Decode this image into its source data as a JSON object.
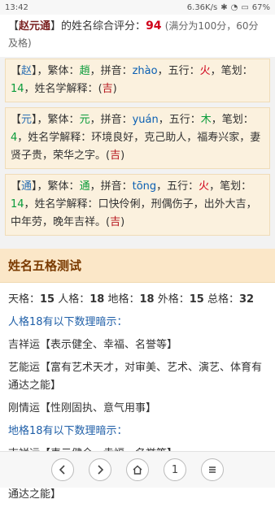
{
  "status": {
    "time": "13:42",
    "network_speed": "6.36K/s",
    "battery": "67%"
  },
  "score": {
    "name_open": "【",
    "name": "赵元通",
    "name_close": "】",
    "text1": "的姓名综合评分：",
    "score_value": "94",
    "note": "(满分为100分，60分及格)"
  },
  "chars": [
    {
      "lb": "【",
      "char": "赵",
      "rb": "】",
      "text_trad_label": "，繁体：",
      "trad": "趙",
      "text_py_label": "，拼音：",
      "pinyin": "zhào",
      "text_wx_label": "，五行：",
      "wuxing": "火",
      "text_bh_label": "，笔划：",
      "strokes": "14",
      "text_expl_label": "，姓名学解释：",
      "expl": "",
      "luck_open": "(",
      "luck": "吉",
      "luck_close": ")"
    },
    {
      "lb": "【",
      "char": "元",
      "rb": "】",
      "text_trad_label": "，繁体：",
      "trad": "元",
      "text_py_label": "，拼音：",
      "pinyin": "yuán",
      "text_wx_label": "，五行：",
      "wuxing": "木",
      "text_bh_label": "，笔划：",
      "strokes": "4",
      "text_expl_label": "，姓名学解释：",
      "expl": "环境良好，克己助人，福寿兴家，妻贤子贵，荣华之字。",
      "luck_open": "(",
      "luck": "吉",
      "luck_close": ")"
    },
    {
      "lb": "【",
      "char": "通",
      "rb": "】",
      "text_trad_label": "，繁体：",
      "trad": "通",
      "text_py_label": "，拼音：",
      "pinyin": "tōng",
      "text_wx_label": "，五行：",
      "wuxing": "火",
      "text_bh_label": "，笔划：",
      "strokes": "14",
      "text_expl_label": "，姓名学解释：",
      "expl": "口快伶俐，刑偶伤子，出外大吉，中年劳，晚年吉祥。",
      "luck_open": "(",
      "luck": "吉",
      "luck_close": ")"
    }
  ],
  "section": {
    "title": "姓名五格测试"
  },
  "wuge": {
    "tian_label": "天格：",
    "tian": "15",
    "ren_label": "人格：",
    "ren": "18",
    "di_label": "地格：",
    "di": "18",
    "wai_label": "外格：",
    "wai": "15",
    "zong_label": "总格：",
    "zong": "32"
  },
  "renge": {
    "heading": "人格18有以下数理暗示：",
    "items": [
      "吉祥运【表示健全、幸福、名誉等】",
      "艺能运【富有艺术天才，对审美、艺术、演艺、体育有通达之能】",
      "刚情运【性刚固执、意气用事】"
    ]
  },
  "dige": {
    "heading": "地格18有以下数理暗示：",
    "items": [
      "吉祥运【表示健全、幸福、名誉等】",
      "艺能运【富有艺术天才，对审美、艺术、演艺、体育有通达之能】"
    ]
  },
  "bottom": {
    "page": "1"
  },
  "icons": {
    "back": "chevron-left-icon",
    "forward": "chevron-right-icon",
    "home": "home-icon",
    "menu": "menu-icon"
  }
}
